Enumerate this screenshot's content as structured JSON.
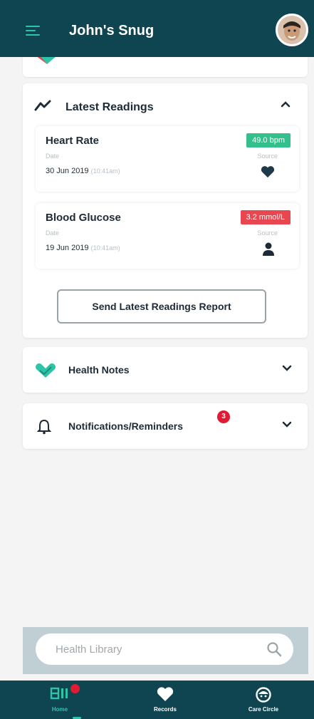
{
  "header": {
    "title": "John's Snug"
  },
  "readings": {
    "title": "Latest Readings",
    "items": [
      {
        "name": "Heart Rate",
        "value": "49.0 bpm",
        "date_label": "Date",
        "date": "30 Jun 2019",
        "time": "(10:41am)",
        "source_label": "Source",
        "source_icon": "heart-icon",
        "status_color": "#34c08d"
      },
      {
        "name": "Blood Glucose",
        "value": "3.2 mmol/L",
        "date_label": "Date",
        "date": "19 Jun 2019",
        "time": "(10:41am)",
        "source_label": "Source",
        "source_icon": "person-icon",
        "status_color": "#e8474f"
      }
    ],
    "send_button": "Send Latest Readings Report"
  },
  "health_notes": {
    "title": "Health Notes"
  },
  "notifications": {
    "title": "Notifications/Reminders",
    "count": "3"
  },
  "search": {
    "placeholder": "Health Library"
  },
  "nav": {
    "items": [
      {
        "label": "Home",
        "icon": "home-icon",
        "active": true
      },
      {
        "label": "Records",
        "icon": "heart-icon",
        "active": false
      },
      {
        "label": "Care Circle",
        "icon": "care-circle-icon",
        "active": false
      }
    ]
  },
  "colors": {
    "header": "#0e4551",
    "accent": "#2fc4a8",
    "alert": "#e11b33"
  }
}
